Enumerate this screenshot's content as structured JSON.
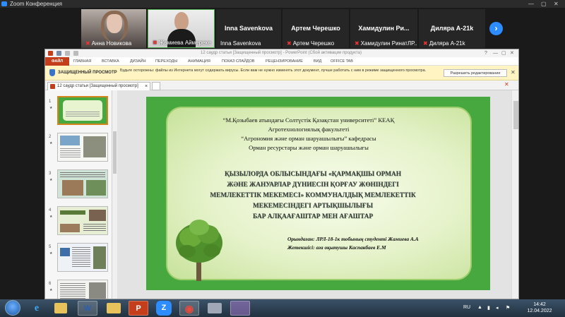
{
  "zoom": {
    "window_title": "Zoom Конференция",
    "participants": [
      {
        "name": "Анна Новикова",
        "muted": true
      },
      {
        "name": "Жамиева Аймереке",
        "muted": true
      },
      {
        "name": "Inna Savenkova",
        "display": "Inna Savenkova"
      },
      {
        "name": "Артем Черешко",
        "display": "Артем Черешко",
        "muted": true
      },
      {
        "name": "Хамидулин РинатЛР...",
        "display": "Хамидулин Ри...",
        "muted": true
      },
      {
        "name": "Диляра А-21k",
        "display": "Диляра А-21k",
        "muted": true
      }
    ],
    "next_icon": "›"
  },
  "ppt": {
    "title_bar": "12 саудр статьи [Защищенный просмотр] - PowerPoint (Сбой активации продукта)",
    "ribbon_file": "ФАЙЛ",
    "ribbon_tabs": [
      "ГЛАВНАЯ",
      "ВСТАВКА",
      "ДИЗАЙН",
      "ПЕРЕХОДЫ",
      "АНИМАЦИЯ",
      "ПОКАЗ СЛАЙДОВ",
      "РЕЦЕНЗИРОВАНИЕ",
      "ВИД",
      "OFFICE TAB"
    ],
    "protected_label": "ЗАЩИЩЕННЫЙ ПРОСМОТР",
    "protected_message": "Будьте осторожны: файлы из Интернета могут содержать вирусы. Если вам не нужно изменять этот документ, лучше работать с ним в режиме защищенного просмотра.",
    "enable_editing": "Разрешить редактирование",
    "doc_tab": "12 саудр статьи [Защищенный просмотр]",
    "thumb_numbers": [
      "1",
      "2",
      "3",
      "4",
      "5",
      "6"
    ],
    "thumb_star": "★"
  },
  "slide": {
    "line1": "“М.Қозыбаев атындағы Солтүстік Қазақстан университеті”  КЕАҚ",
    "line2": "Агротехнологиялық факультеті",
    "line3": "“Агрономия және орман шаруашылығы” кафедрасы",
    "line4": "Орман ресурстары және орман шаруашылығы",
    "heading": [
      "ҚЫЗЫЛОРДА ОБЛЫСЫНДАҒЫ «ҚАРМАҚШЫ ОРМАН",
      "ЖӘНЕ ЖАНУАРЛАР ДҮНИЕСІН ҚОРҒАУ ЖӨНІНДЕГІ",
      "МЕМЛЕКЕТТІК МЕКЕМЕСІ» КОММУНАЛДЫҚ МЕМЛЕКЕТТІК",
      "МЕКЕМЕСІНДЕГІ АРТЫҚШЫЛЫҒЫ",
      "БАР АЛҚААҒАШТАР МЕН АҒАШТАР"
    ],
    "performer": "Орындаған: ЛРЛ-18-1к тобының студенті Жамиева А.А",
    "supervisor": "Жетекшісі: аға оқытушы Каспакбаев Е.М"
  },
  "taskbar": {
    "apps": [
      "e",
      "W",
      "P",
      "Z",
      "◉"
    ],
    "language": "RU",
    "time": "14:42",
    "date": "12.04.2022"
  }
}
